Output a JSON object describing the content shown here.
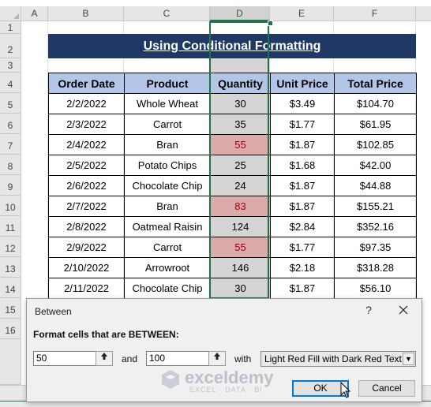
{
  "columns": [
    "A",
    "B",
    "C",
    "D",
    "E",
    "F"
  ],
  "rows": [
    "1",
    "2",
    "3",
    "4",
    "5",
    "6",
    "7",
    "8",
    "9",
    "10",
    "11",
    "12",
    "13",
    "14",
    "15",
    "16"
  ],
  "title": "Using Conditional Formatting",
  "table": {
    "headers": [
      "Order Date",
      "Product",
      "Quantity",
      "Unit Price",
      "Total Price"
    ],
    "rows": [
      {
        "date": "2/2/2022",
        "product": "Whole Wheat",
        "qty": "30",
        "unit": "$3.49",
        "total": "$104.70",
        "highlight": false
      },
      {
        "date": "2/3/2022",
        "product": "Carrot",
        "qty": "35",
        "unit": "$1.77",
        "total": "$61.95",
        "highlight": false
      },
      {
        "date": "2/4/2022",
        "product": "Bran",
        "qty": "55",
        "unit": "$1.87",
        "total": "$102.85",
        "highlight": true
      },
      {
        "date": "2/5/2022",
        "product": "Potato Chips",
        "qty": "25",
        "unit": "$1.68",
        "total": "$42.00",
        "highlight": false
      },
      {
        "date": "2/6/2022",
        "product": "Chocolate Chip",
        "qty": "24",
        "unit": "$1.87",
        "total": "$44.88",
        "highlight": false
      },
      {
        "date": "2/7/2022",
        "product": "Bran",
        "qty": "83",
        "unit": "$1.87",
        "total": "$155.21",
        "highlight": true
      },
      {
        "date": "2/8/2022",
        "product": "Oatmeal Raisin",
        "qty": "124",
        "unit": "$2.84",
        "total": "$352.16",
        "highlight": false
      },
      {
        "date": "2/9/2022",
        "product": "Carrot",
        "qty": "55",
        "unit": "$1.77",
        "total": "$97.35",
        "highlight": true
      },
      {
        "date": "2/10/2022",
        "product": "Arrowroot",
        "qty": "146",
        "unit": "$2.18",
        "total": "$318.28",
        "highlight": false
      },
      {
        "date": "2/11/2022",
        "product": "Chocolate Chip",
        "qty": "30",
        "unit": "$1.87",
        "total": "$56.10",
        "highlight": false
      }
    ]
  },
  "dialog": {
    "title": "Between",
    "help": "?",
    "label": "Format cells that are BETWEEN:",
    "from_value": "50",
    "and_label": "and",
    "to_value": "100",
    "with_label": "with",
    "format_option": "Light Red Fill with Dark Red Text",
    "ok_label": "OK",
    "cancel_label": "Cancel"
  },
  "watermark": {
    "name": "exceldemy",
    "sub": "EXCEL · DATA · BI"
  },
  "colors": {
    "header_fill": "#b4c6e7",
    "title_fill": "#203864",
    "highlight_fill": "#ddaaaa",
    "highlight_text": "#9c0006",
    "selection": "#217346"
  }
}
